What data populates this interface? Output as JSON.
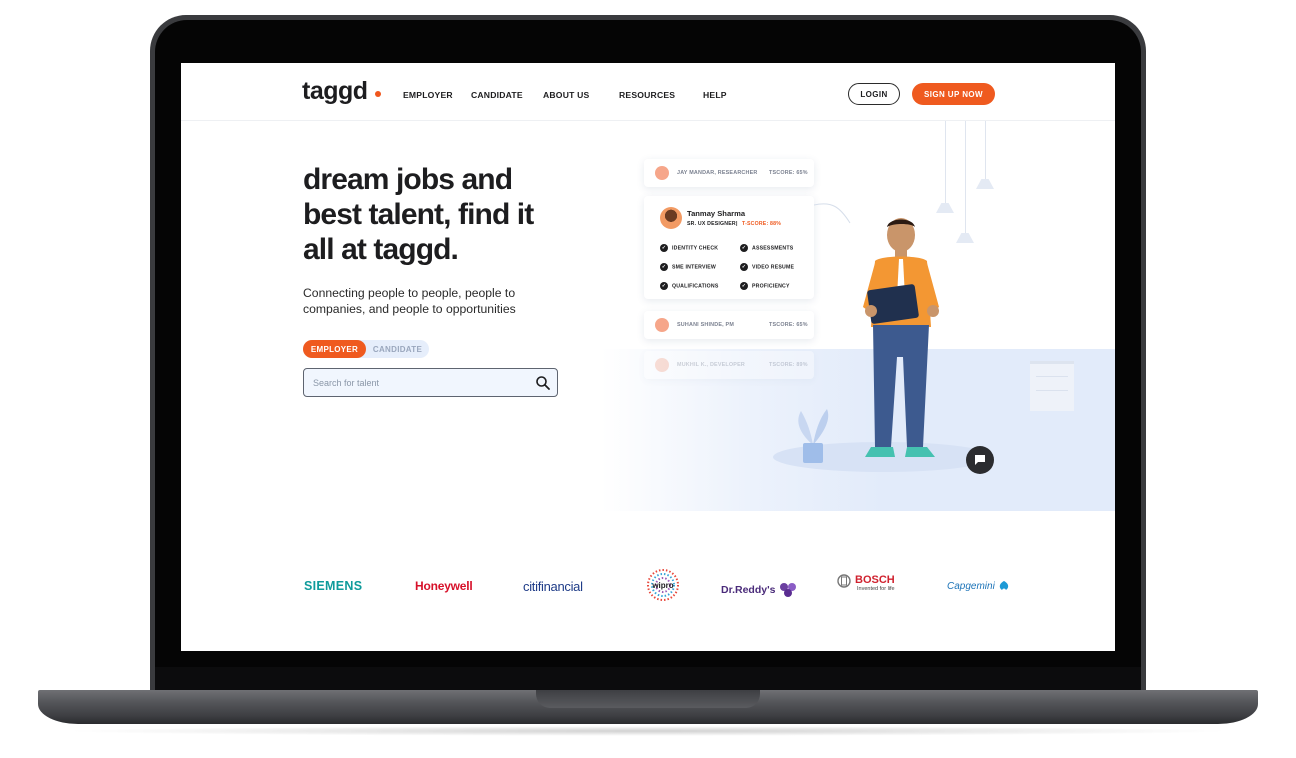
{
  "header": {
    "logo_text": "taggd",
    "nav": [
      "EMPLOYER",
      "CANDIDATE",
      "ABOUT US",
      "RESOURCES",
      "HELP"
    ],
    "login_label": "LOGIN",
    "signup_label": "SIGN UP NOW"
  },
  "hero": {
    "headline_lines": [
      "dream jobs and",
      "best talent, find it",
      "all at taggd."
    ],
    "subtitle_lines": [
      "Connecting people to people, people to",
      "companies, and people to opportunities"
    ],
    "toggle": {
      "employer": "EMPLOYER",
      "candidate": "CANDIDATE",
      "active": "employer"
    },
    "search": {
      "placeholder": "Search for talent",
      "value": ""
    }
  },
  "illustration": {
    "cards": [
      {
        "name": "JAY MANDAR, RESEARCHER",
        "score": "TSCORE: 65%"
      },
      {
        "name": "SUHANI SHINDE, PM",
        "score": "TSCORE: 65%"
      },
      {
        "name": "MUKHIL K., DEVELOPER",
        "score": "TSCORE: 89%"
      }
    ],
    "featured": {
      "name": "Tanmay Sharma",
      "role": "SR. UX DESIGNER",
      "separator": "|",
      "score": "T-SCORE: 88%",
      "checks": [
        "IDENTITY CHECK",
        "ASSESSMENTS",
        "SME INTERVIEW",
        "VIDEO RESUME",
        "QUALIFICATIONS",
        "PROFICIENCY"
      ]
    }
  },
  "logos": {
    "siemens": "SIEMENS",
    "honeywell": "Honeywell",
    "citi": "citifinancial",
    "wipro": "wipro",
    "drreddy": "Dr.Reddy's",
    "bosch": "BOSCH",
    "bosch_tag": "Invented for life",
    "capgemini": "Capgemini"
  },
  "colors": {
    "accent": "#ef5a1f",
    "text": "#1d1d1f",
    "panel": "#e2ebfa"
  },
  "icons": [
    "search-icon",
    "chat-icon",
    "check-icon",
    "avatar-icon"
  ]
}
